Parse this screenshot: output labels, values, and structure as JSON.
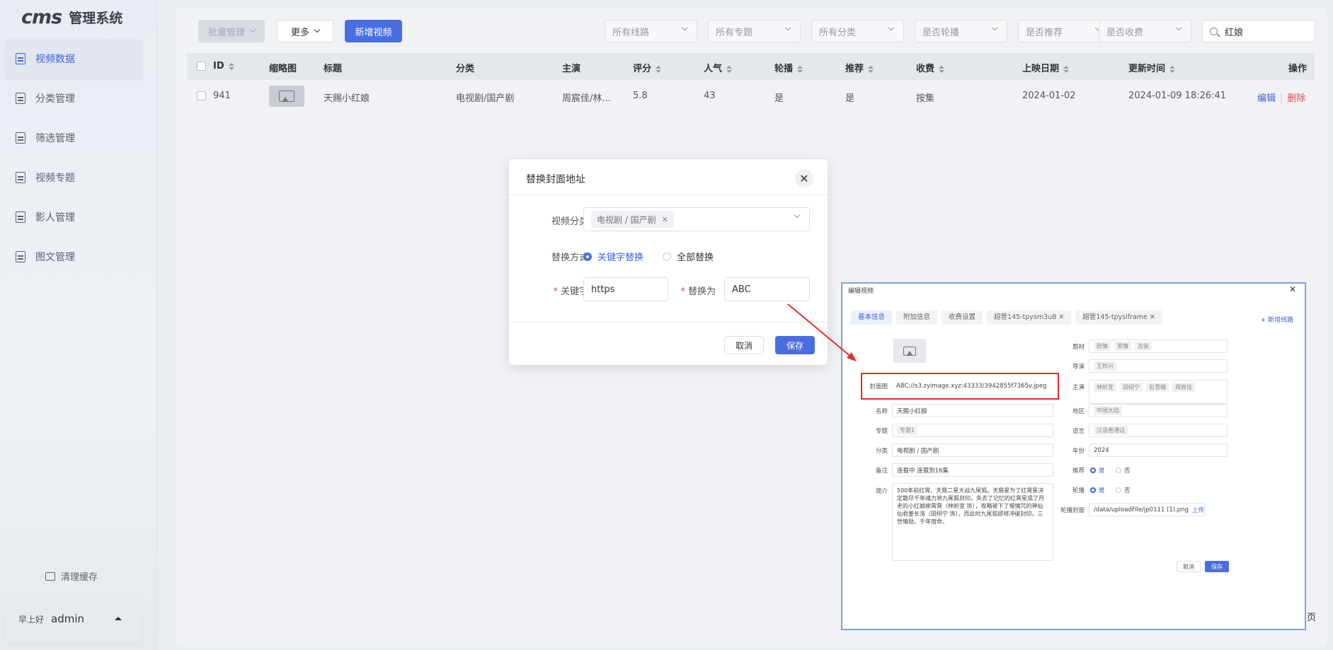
{
  "app": {
    "logo_main": "cms",
    "logo_text": "管理系统"
  },
  "sidebar": {
    "items": [
      {
        "label": "视频数据",
        "active": true
      },
      {
        "label": "分类管理",
        "active": false
      },
      {
        "label": "筛选管理",
        "active": false
      },
      {
        "label": "视频专题",
        "active": false
      },
      {
        "label": "影人管理",
        "active": false
      },
      {
        "label": "图文管理",
        "active": false
      }
    ],
    "clear_cache": "清理缓存",
    "greeting": "早上好",
    "username": "admin"
  },
  "toolbar": {
    "batch": "批量管理",
    "more": "更多",
    "add": "新增视频",
    "filters": [
      "所有线路",
      "所有专题",
      "所有分类",
      "是否轮播",
      "是否推荐",
      "是否收费"
    ],
    "search_value": "红娘"
  },
  "table": {
    "headers": [
      "ID",
      "缩略图",
      "标题",
      "分类",
      "主演",
      "评分",
      "人气",
      "轮播",
      "推荐",
      "收费",
      "上映日期",
      "更新时间",
      "操作"
    ],
    "rows": [
      {
        "id": "941",
        "title": "天赐小红娘",
        "category": "电视剧/国产剧",
        "actors": "周宸佳/林...",
        "score": "5.8",
        "popularity": "43",
        "carousel": "是",
        "recommend": "是",
        "charge": "按集",
        "release": "2024-01-02",
        "updated": "2024-01-09 18:26:41",
        "edit": "编辑",
        "delete": "删除"
      }
    ]
  },
  "dialog": {
    "title": "替换封面地址",
    "category_label": "视频分类",
    "category_tag": "电视剧 / 国产剧",
    "method_label": "替换方式",
    "method_keyword": "关键字替换",
    "method_all": "全部替换",
    "keyword_label": "关键字",
    "keyword_value": "https",
    "replace_label": "替换为",
    "replace_value": "ABC",
    "cancel": "取消",
    "save": "保存"
  },
  "inset": {
    "title": "编辑视频",
    "tabs": [
      "基本信息",
      "附加信息",
      "收费设置",
      "超管145-tpysm3u8",
      "超管145-tpyslframe"
    ],
    "add_line": "+ 新增线路",
    "cover_label": "封面图",
    "cover_value": "ABC://s3.zyimage.xyz:43333/3942855f7365v.jpeg",
    "name_label": "名称",
    "name_value": "天赐小红娘",
    "topic_label": "专题",
    "topic_tag": "专题1",
    "category_label": "分类",
    "category_value": "电视剧 / 国产剧",
    "remark_label": "备注",
    "remark_value": "连载中 连载到16集",
    "intro_label": "简介",
    "intro_value": "500年前红霄、天鼎二星大战九尾狐。天鼎星为了红霄星决定散尽千年魂力将九尾狐封印。失去了记忆的红霄星成了月老的小红娘柳霄霄（林昕宜 饰），攻略被下了噬情咒的神仙仙君姜长洛（田栩宁 饰），而此时九尾狐即将冲破封印。三世情劫，千年宿命。",
    "theme_label": "题材",
    "theme_tags": [
      "剧情",
      "爱情",
      "古装"
    ],
    "director_label": "导演",
    "director_tags": [
      "王秋兴"
    ],
    "actor_label": "主演",
    "actor_tags": [
      "林昕宜",
      "田栩宁",
      "石雪婧",
      "周宸佳"
    ],
    "region_label": "地区",
    "region_tags": [
      "中国大陆"
    ],
    "lang_label": "语言",
    "lang_tags": [
      "汉语普通话"
    ],
    "year_label": "年份",
    "year_value": "2024",
    "rec_label": "推荐",
    "carousel_label": "轮播",
    "yes": "是",
    "no": "否",
    "carousel_cover_label": "轮播封面",
    "carousel_cover_value": "/data/uploadFile/jp0111 (1).png",
    "upload": "上传",
    "cancel": "取消",
    "save": "保存"
  },
  "page_fragment": "页",
  "colors": {
    "primary": "#4a6ee0",
    "danger": "#e0474f",
    "highlight": "#e02d2d"
  }
}
